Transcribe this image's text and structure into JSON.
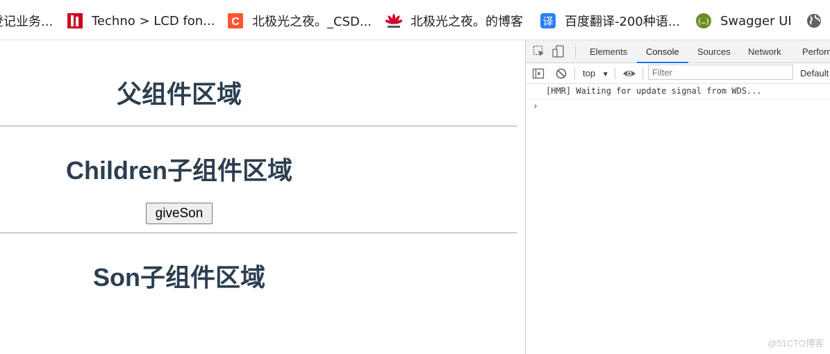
{
  "bookmarks": [
    {
      "label": "登记业务...",
      "icon": "registration-icon"
    },
    {
      "label": "Techno > LCD fon...",
      "icon": "techno-icon",
      "color": "#d0021b"
    },
    {
      "label": "北极光之夜。_CSD...",
      "icon": "csdn-icon",
      "color": "#fc5531"
    },
    {
      "label": "北极光之夜。的博客",
      "icon": "huawei-icon",
      "color": "#cf0a2c"
    },
    {
      "label": "百度翻译-200种语...",
      "icon": "baidu-translate-icon",
      "color": "#2b7ff6"
    },
    {
      "label": "Swagger UI",
      "icon": "swagger-icon",
      "color": "#6b8e23"
    },
    {
      "label": "",
      "icon": "globe-icon"
    }
  ],
  "app": {
    "parent_title": "父组件区域",
    "children_title": "Children子组件区域",
    "give_button": "giveSon",
    "son_title": "Son子组件区域",
    "heading_color": "#2c3e50"
  },
  "devtools": {
    "tabs": [
      "Elements",
      "Console",
      "Sources",
      "Network",
      "Perform"
    ],
    "active_tab": "Console",
    "context": "top",
    "filter_placeholder": "Filter",
    "levels": "Default",
    "console_message": "[HMR] Waiting for update signal from WDS...",
    "prompt": "›",
    "accent": "#1a73e8"
  },
  "watermark": "@51CTO博客"
}
